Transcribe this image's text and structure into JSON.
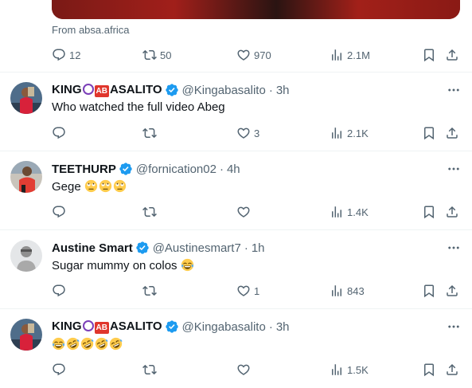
{
  "top_post": {
    "source": "From absa.africa",
    "replies": "12",
    "reposts": "50",
    "likes": "970",
    "views": "2.1M"
  },
  "replies": [
    {
      "name_pre": "KING",
      "name_badge": "AB",
      "name_post": "ASALITO",
      "handle": "@Kingabasalito",
      "time": "3h",
      "text": "Who watched the full video Abeg",
      "replies": "",
      "reposts": "",
      "likes": "3",
      "views": "2.1K"
    },
    {
      "name": "TEETHURP",
      "handle": "@fornication02",
      "time": "4h",
      "text": "Gege",
      "emoji": [
        "eye-roll-emoji",
        "eye-roll-emoji",
        "eye-roll-emoji"
      ],
      "replies": "",
      "reposts": "",
      "likes": "",
      "views": "1.4K"
    },
    {
      "name": "Austine Smart",
      "handle": "@Austinesmart7",
      "time": "1h",
      "text": "Sugar mummy on colos",
      "emoji": [
        "tears-of-joy-emoji"
      ],
      "replies": "",
      "reposts": "",
      "likes": "1",
      "views": "843"
    },
    {
      "name_pre": "KING",
      "name_badge": "AB",
      "name_post": "ASALITO",
      "handle": "@Kingabasalito",
      "time": "3h",
      "text": "",
      "emoji": [
        "tears-of-joy-emoji",
        "rofl-emoji",
        "rofl-emoji",
        "rofl-emoji",
        "rofl-emoji"
      ],
      "replies": "",
      "reposts": "",
      "likes": "",
      "views": "1.5K"
    }
  ],
  "separator": "·",
  "colors": {
    "text": "#0f1419",
    "secondary": "#536471",
    "verified": "#1d9bf0",
    "divider": "#eff3f4"
  }
}
